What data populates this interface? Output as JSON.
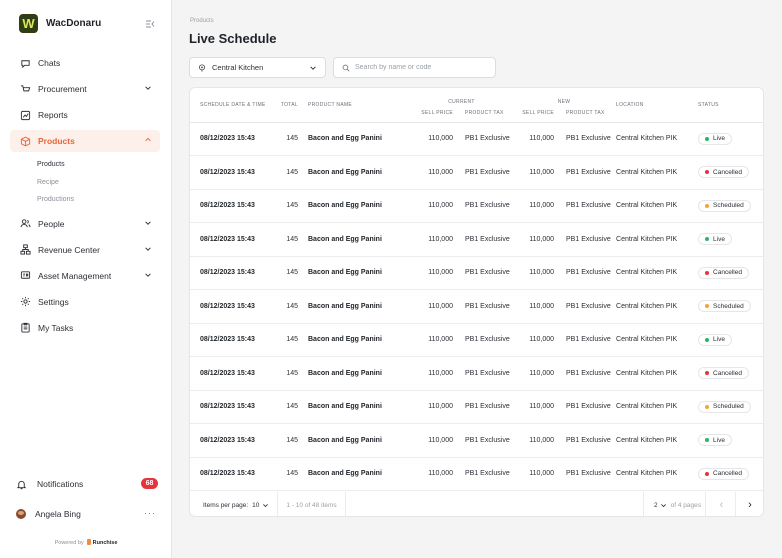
{
  "brand": {
    "logo_letter": "W",
    "name": "WacDonaru"
  },
  "sidebar": {
    "items": [
      {
        "label": "Chats",
        "icon": "chat-icon",
        "chevron": false
      },
      {
        "label": "Procurement",
        "icon": "cart-icon",
        "chevron": true
      },
      {
        "label": "Reports",
        "icon": "chart-icon",
        "chevron": false
      },
      {
        "label": "Products",
        "icon": "box-icon",
        "chevron": true,
        "active": true,
        "sub": [
          "Products",
          "Recipe",
          "Productions"
        ]
      },
      {
        "label": "People",
        "icon": "people-icon",
        "chevron": true
      },
      {
        "label": "Revenue Center",
        "icon": "network-icon",
        "chevron": true
      },
      {
        "label": "Asset Management",
        "icon": "asset-icon",
        "chevron": true
      },
      {
        "label": "Settings",
        "icon": "gear-icon",
        "chevron": false
      },
      {
        "label": "My Tasks",
        "icon": "clipboard-icon",
        "chevron": false
      }
    ],
    "notifications": {
      "label": "Notifications",
      "count": "68"
    },
    "user": {
      "name": "Angela Bing",
      "menu": "···"
    },
    "powered_by": {
      "prefix": "Powered by",
      "name": "Runchise"
    }
  },
  "main": {
    "breadcrumb": "Products",
    "title": "Live Schedule",
    "location_select": "Central Kitchen",
    "search_placeholder": "Search by name or code"
  },
  "table": {
    "headers": {
      "date": "SCHEDULE DATE & TIME",
      "total": "TOTAL",
      "product": "PRODUCT NAME",
      "current": "CURRENT",
      "new": "NEW",
      "sell_price": "SELL PRICE",
      "product_tax": "PRODUCT TAX",
      "location": "LOCATION",
      "status": "STATUS"
    },
    "rows": [
      {
        "date": "08/12/2023 15:43",
        "total": "145",
        "name": "Bacon and Egg Panini",
        "cur_price": "110,000",
        "cur_tax": "PB1 Exclusive",
        "new_price": "110,000",
        "new_tax": "PB1 Exclusive",
        "location": "Central Kitchen PIK",
        "status": "Live"
      },
      {
        "date": "08/12/2023 15:43",
        "total": "145",
        "name": "Bacon and Egg Panini",
        "cur_price": "110,000",
        "cur_tax": "PB1 Exclusive",
        "new_price": "110,000",
        "new_tax": "PB1 Exclusive",
        "location": "Central Kitchen PIK",
        "status": "Cancelled"
      },
      {
        "date": "08/12/2023 15:43",
        "total": "145",
        "name": "Bacon and Egg Panini",
        "cur_price": "110,000",
        "cur_tax": "PB1 Exclusive",
        "new_price": "110,000",
        "new_tax": "PB1 Exclusive",
        "location": "Central Kitchen PIK",
        "status": "Scheduled"
      },
      {
        "date": "08/12/2023 15:43",
        "total": "145",
        "name": "Bacon and Egg Panini",
        "cur_price": "110,000",
        "cur_tax": "PB1 Exclusive",
        "new_price": "110,000",
        "new_tax": "PB1 Exclusive",
        "location": "Central Kitchen PIK",
        "status": "Live"
      },
      {
        "date": "08/12/2023 15:43",
        "total": "145",
        "name": "Bacon and Egg Panini",
        "cur_price": "110,000",
        "cur_tax": "PB1 Exclusive",
        "new_price": "110,000",
        "new_tax": "PB1 Exclusive",
        "location": "Central Kitchen PIK",
        "status": "Cancelled"
      },
      {
        "date": "08/12/2023 15:43",
        "total": "145",
        "name": "Bacon and Egg Panini",
        "cur_price": "110,000",
        "cur_tax": "PB1 Exclusive",
        "new_price": "110,000",
        "new_tax": "PB1 Exclusive",
        "location": "Central Kitchen PIK",
        "status": "Scheduled"
      },
      {
        "date": "08/12/2023 15:43",
        "total": "145",
        "name": "Bacon and Egg Panini",
        "cur_price": "110,000",
        "cur_tax": "PB1 Exclusive",
        "new_price": "110,000",
        "new_tax": "PB1 Exclusive",
        "location": "Central Kitchen PIK",
        "status": "Live"
      },
      {
        "date": "08/12/2023 15:43",
        "total": "145",
        "name": "Bacon and Egg Panini",
        "cur_price": "110,000",
        "cur_tax": "PB1 Exclusive",
        "new_price": "110,000",
        "new_tax": "PB1 Exclusive",
        "location": "Central Kitchen PIK",
        "status": "Cancelled"
      },
      {
        "date": "08/12/2023 15:43",
        "total": "145",
        "name": "Bacon and Egg Panini",
        "cur_price": "110,000",
        "cur_tax": "PB1 Exclusive",
        "new_price": "110,000",
        "new_tax": "PB1 Exclusive",
        "location": "Central Kitchen PIK",
        "status": "Scheduled"
      },
      {
        "date": "08/12/2023 15:43",
        "total": "145",
        "name": "Bacon and Egg Panini",
        "cur_price": "110,000",
        "cur_tax": "PB1 Exclusive",
        "new_price": "110,000",
        "new_tax": "PB1 Exclusive",
        "location": "Central Kitchen PIK",
        "status": "Live"
      },
      {
        "date": "08/12/2023 15:43",
        "total": "145",
        "name": "Bacon and Egg Panini",
        "cur_price": "110,000",
        "cur_tax": "PB1 Exclusive",
        "new_price": "110,000",
        "new_tax": "PB1 Exclusive",
        "location": "Central Kitchen PIK",
        "status": "Cancelled"
      }
    ],
    "status_colors": {
      "Live": "#2fb36a",
      "Cancelled": "#e5343c",
      "Scheduled": "#f2a33a"
    }
  },
  "pagination": {
    "items_per_page_label": "Items per page:",
    "items_per_page": "10",
    "range": "1 - 10 of 48 items",
    "page": "2",
    "of_pages": "of 4 pages",
    "prev": "‹",
    "next": "›"
  },
  "colors": {
    "accent": "#e8673a",
    "brand_bg": "#2f3d14",
    "brand_fg": "#d8e85a"
  }
}
